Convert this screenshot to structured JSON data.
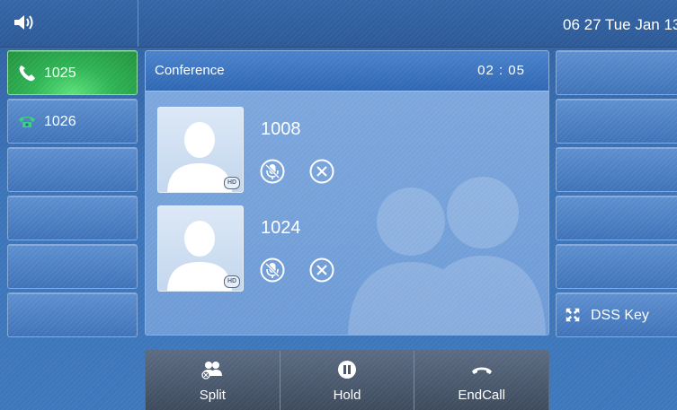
{
  "status_bar": {
    "datetime": "06 27 Tue Jan 13",
    "volume_icon": "speaker-icon"
  },
  "line_keys_left": [
    {
      "label": "1025",
      "state": "active",
      "icon": "handset-active-icon"
    },
    {
      "label": "1026",
      "state": "idle",
      "icon": "handset-idle-icon"
    },
    {
      "label": ""
    },
    {
      "label": ""
    },
    {
      "label": ""
    },
    {
      "label": ""
    }
  ],
  "line_keys_right": [
    {
      "label": ""
    },
    {
      "label": ""
    },
    {
      "label": ""
    },
    {
      "label": ""
    },
    {
      "label": ""
    },
    {
      "label": "DSS Key",
      "icon": "expand-icon"
    }
  ],
  "call_panel": {
    "title": "Conference",
    "timer": "02 : 05",
    "participants": [
      {
        "number": "1008",
        "hd": "HD"
      },
      {
        "number": "1024",
        "hd": "HD"
      }
    ]
  },
  "softkeys": [
    {
      "label": "Split",
      "icon": "split-icon"
    },
    {
      "label": "Hold",
      "icon": "pause-icon"
    },
    {
      "label": "EndCall",
      "icon": "hang-up-icon"
    }
  ],
  "colors": {
    "accent_green": "#2eb354",
    "background_blue": "#3c74b8",
    "softkey_gray": "#4a586c"
  }
}
